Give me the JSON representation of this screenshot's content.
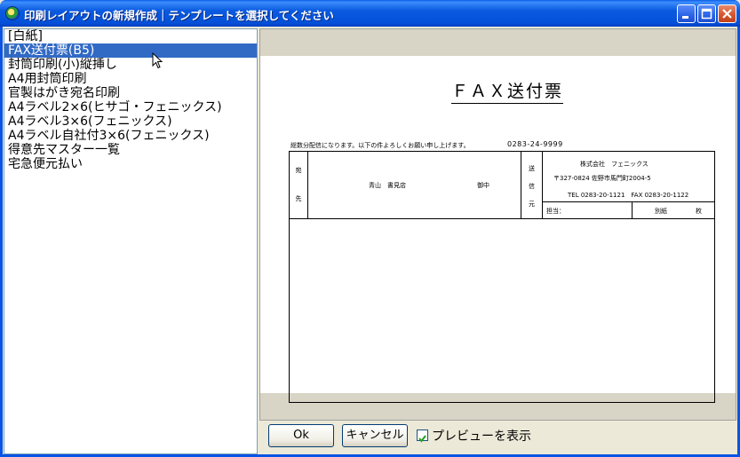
{
  "window": {
    "title": "印刷レイアウトの新規作成｜テンプレートを選択してください"
  },
  "template_list": {
    "items": [
      "[白紙]",
      "FAX送付票(B5)",
      "封筒印刷(小)縦挿し",
      "A4用封筒印刷",
      "官製はがき宛名印刷",
      "A4ラベル2×6(ヒサゴ・フェニックス)",
      "A4ラベル3×6(フェニックス)",
      "A4ラベル自社付3×6(フェニックス)",
      "得意先マスター一覧",
      "宅急便元払い"
    ],
    "selected_index": 1
  },
  "preview": {
    "fax_title": "ＦＡＸ送付票",
    "note": "総数分配信になります。以下の件よろしくお願い申し上げます。",
    "phone": "0283-24-9999",
    "to_label_1": "宛",
    "to_label_2": "先",
    "to_name": "青山　書見店",
    "to_suffix": "御中",
    "from_label_1": "送",
    "from_label_2": "信",
    "from_label_3": "元",
    "company": "株式会社　フェニックス",
    "address": "〒327-0824 佐野市馬門町2004-5",
    "tel_fax": "TEL 0283-20-1121　FAX 0283-20-1122",
    "staff_label": "担当：",
    "pages_label": "別紙",
    "pages_unit": "枚"
  },
  "controls": {
    "ok_label": "Ok",
    "cancel_label": "キャンセル",
    "preview_checkbox_label": "プレビューを表示",
    "preview_checked": true
  }
}
